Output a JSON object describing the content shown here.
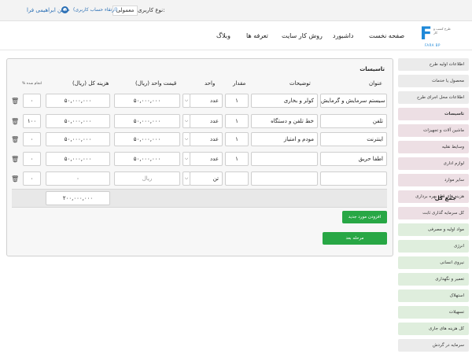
{
  "topbar": {
    "user_type_label": "نوع کاربری:",
    "user_type_value": "معمولی",
    "upgrade_link": "(ارتقاء حساب کاربری)",
    "user_name": "حسن ابراهیمی فرا"
  },
  "logo": {
    "letter": "F",
    "tagline": "طرح کسب و کار",
    "subtitle": "FARA BP"
  },
  "nav": {
    "items": [
      "صفحه نخست",
      "داشبورد",
      "روش کار سایت",
      "تعرفه ها",
      "وبلاگ"
    ]
  },
  "sidebar": {
    "items": [
      "اطلاعات اولیه طرح",
      "محصول یا خدمات",
      "اطلاعات محل اجرای طرح",
      "تاسیسات",
      "ماشین آلات و تجهیزات",
      "وسایط نقلیه",
      "لوازم اداری",
      "سایر موارد",
      "هزینه های قبل بهره برداری",
      "کل سرمایه گذاری ثابت",
      "مواد اولیه و مصرفی",
      "انرژی",
      "نیروی انسانی",
      "تعمیر و نگهداری",
      "استهلاک",
      "تسهیلات",
      "کل هزینه های جاری",
      "سرمایه در گردش"
    ]
  },
  "panel": {
    "title": "تاسیسات",
    "headers": {
      "title": "عنوان",
      "description": "توضیحات",
      "quantity": "مقدار",
      "unit": "واحد",
      "unit_price": "قیمت واحد (ریال)",
      "total_cost": "هزینه کل (ریال)",
      "percent_done": "% انجام شده"
    },
    "rows": [
      {
        "title": "سیستم سرمایش و گرمایش",
        "description": "کولر و بخاری",
        "quantity": "۱",
        "unit": "عدد",
        "unit_price": "۵۰,۰۰۰,۰۰۰",
        "total": "۵۰,۰۰۰,۰۰۰",
        "percent": "۰"
      },
      {
        "title": "تلفن",
        "description": "خط تلفن و دستگاه",
        "quantity": "۱",
        "unit": "عدد",
        "unit_price": "۵۰,۰۰۰,۰۰۰",
        "total": "۵۰,۰۰۰,۰۰۰",
        "percent": "۱۰۰"
      },
      {
        "title": "اینترنت",
        "description": "مودم و امتیاز",
        "quantity": "۱",
        "unit": "عدد",
        "unit_price": "۵۰,۰۰۰,۰۰۰",
        "total": "۵۰,۰۰۰,۰۰۰",
        "percent": "۰"
      },
      {
        "title": "اطفا حریق",
        "description": "",
        "quantity": "۱",
        "unit": "عدد",
        "unit_price": "۵۰,۰۰۰,۰۰۰",
        "total": "۵۰,۰۰۰,۰۰۰",
        "percent": "۰"
      },
      {
        "title": "",
        "description": "",
        "quantity": "",
        "unit": "تن",
        "unit_price_placeholder": "ریال",
        "total": "۰",
        "percent": "۰"
      }
    ],
    "total_label": "جمع کل",
    "total_value": "۲۰۰,۰۰۰,۰۰۰",
    "add_button": "افزودن مورد جدید",
    "next_button": "مرحله بعد"
  }
}
